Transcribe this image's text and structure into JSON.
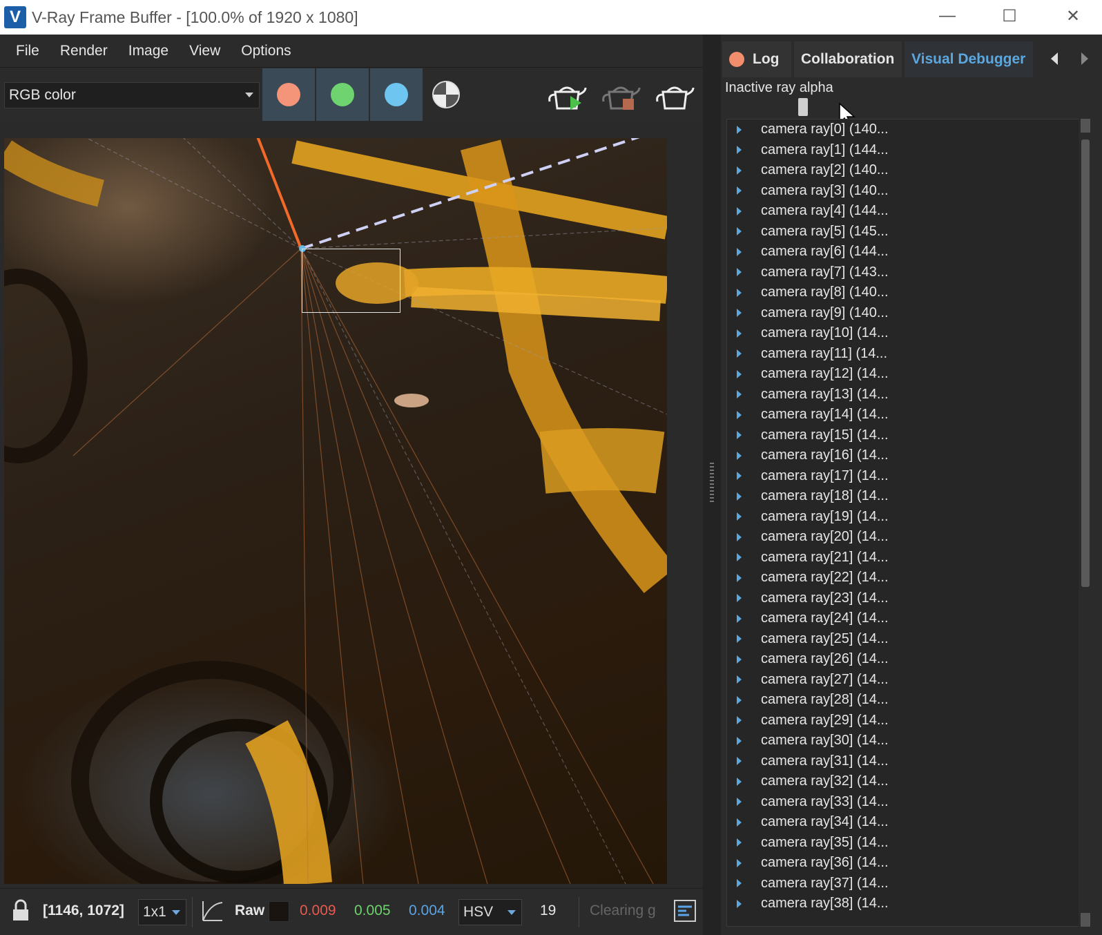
{
  "window": {
    "title": "V-Ray Frame Buffer - [100.0% of 1920 x 1080]",
    "app_icon_glyph": "V",
    "minimize_glyph": "—",
    "maximize_glyph": "☐",
    "close_glyph": "✕"
  },
  "menu": [
    "File",
    "Render",
    "Image",
    "View",
    "Options"
  ],
  "toolbar": {
    "channel": "RGB color",
    "swatches": [
      {
        "name": "red-channel-icon",
        "color": "#f4957a"
      },
      {
        "name": "green-channel-icon",
        "color": "#6fd36f"
      },
      {
        "name": "blue-channel-icon",
        "color": "#6ec6f0"
      }
    ],
    "icons": [
      "monochrome-icon",
      "start-render-icon",
      "stop-render-icon",
      "render-last-icon"
    ]
  },
  "status": {
    "coords": "[1146, 1072]",
    "sample_size": "1x1",
    "raw_label": "Raw",
    "r": "0.009",
    "g": "0.005",
    "b": "0.004",
    "color_mode": "HSV",
    "value": "19",
    "message": "Clearing g",
    "colors": {
      "r": "#e85a4f",
      "g": "#6ed36b",
      "b": "#5aa4e8"
    }
  },
  "panel": {
    "tabs": [
      "Log",
      "Collaboration",
      "Visual Debugger"
    ],
    "active_tab": "Visual Debugger",
    "inactive_ray_alpha_label": "Inactive ray alpha",
    "rays": [
      "camera ray[0] (140...",
      "camera ray[1] (144...",
      "camera ray[2] (140...",
      "camera ray[3] (140...",
      "camera ray[4] (144...",
      "camera ray[5] (145...",
      "camera ray[6] (144...",
      "camera ray[7] (143...",
      "camera ray[8] (140...",
      "camera ray[9] (140...",
      "camera ray[10] (14...",
      "camera ray[11] (14...",
      "camera ray[12] (14...",
      "camera ray[13] (14...",
      "camera ray[14] (14...",
      "camera ray[15] (14...",
      "camera ray[16] (14...",
      "camera ray[17] (14...",
      "camera ray[18] (14...",
      "camera ray[19] (14...",
      "camera ray[20] (14...",
      "camera ray[21] (14...",
      "camera ray[22] (14...",
      "camera ray[23] (14...",
      "camera ray[24] (14...",
      "camera ray[25] (14...",
      "camera ray[26] (14...",
      "camera ray[27] (14...",
      "camera ray[28] (14...",
      "camera ray[29] (14...",
      "camera ray[30] (14...",
      "camera ray[31] (14...",
      "camera ray[32] (14...",
      "camera ray[33] (14...",
      "camera ray[34] (14...",
      "camera ray[35] (14...",
      "camera ray[36] (14...",
      "camera ray[37] (14...",
      "camera ray[38] (14..."
    ]
  }
}
